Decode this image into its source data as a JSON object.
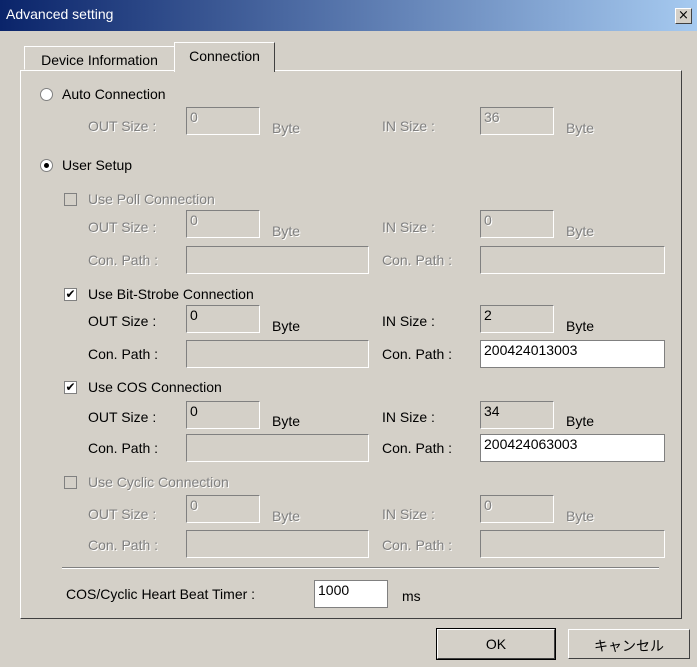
{
  "window": {
    "title": "Advanced setting",
    "close_glyph": "×"
  },
  "tabs": {
    "device_info": "Device Information",
    "connection": "Connection"
  },
  "auto_connection": {
    "label": "Auto Connection",
    "selected": false,
    "out_label": "OUT Size :",
    "out_value": "0",
    "out_unit": "Byte",
    "in_label": "IN Size :",
    "in_value": "36",
    "in_unit": "Byte"
  },
  "user_setup": {
    "label": "User Setup",
    "selected": true
  },
  "poll": {
    "label": "Use Poll Connection",
    "checked": false,
    "out_label": "OUT Size :",
    "out_value": "0",
    "out_unit": "Byte",
    "in_label": "IN Size :",
    "in_value": "0",
    "in_unit": "Byte",
    "out_path_label": "Con. Path :",
    "out_path": "",
    "in_path_label": "Con. Path :",
    "in_path": ""
  },
  "bitstrobe": {
    "label": "Use Bit-Strobe Connection",
    "checked": true,
    "out_label": "OUT Size :",
    "out_value": "0",
    "out_unit": "Byte",
    "in_label": "IN Size :",
    "in_value": "2",
    "in_unit": "Byte",
    "out_path_label": "Con. Path :",
    "out_path": "",
    "in_path_label": "Con. Path :",
    "in_path": "200424013003"
  },
  "cos": {
    "label": "Use COS Connection",
    "checked": true,
    "out_label": "OUT Size :",
    "out_value": "0",
    "out_unit": "Byte",
    "in_label": "IN Size :",
    "in_value": "34",
    "in_unit": "Byte",
    "out_path_label": "Con. Path :",
    "out_path": "",
    "in_path_label": "Con. Path :",
    "in_path": "200424063003"
  },
  "cyclic": {
    "label": "Use Cyclic Connection",
    "checked": false,
    "out_label": "OUT Size :",
    "out_value": "0",
    "out_unit": "Byte",
    "in_label": "IN Size :",
    "in_value": "0",
    "in_unit": "Byte",
    "out_path_label": "Con. Path :",
    "out_path": "",
    "in_path_label": "Con. Path :",
    "in_path": ""
  },
  "heartbeat": {
    "label": "COS/Cyclic Heart Beat Timer :",
    "value": "1000",
    "unit": "ms"
  },
  "buttons": {
    "ok": "OK",
    "cancel": "キャンセル"
  },
  "colors": {
    "titlebar_start": "#0a246a",
    "titlebar_end": "#a6caf0",
    "face": "#d4d0c8"
  }
}
